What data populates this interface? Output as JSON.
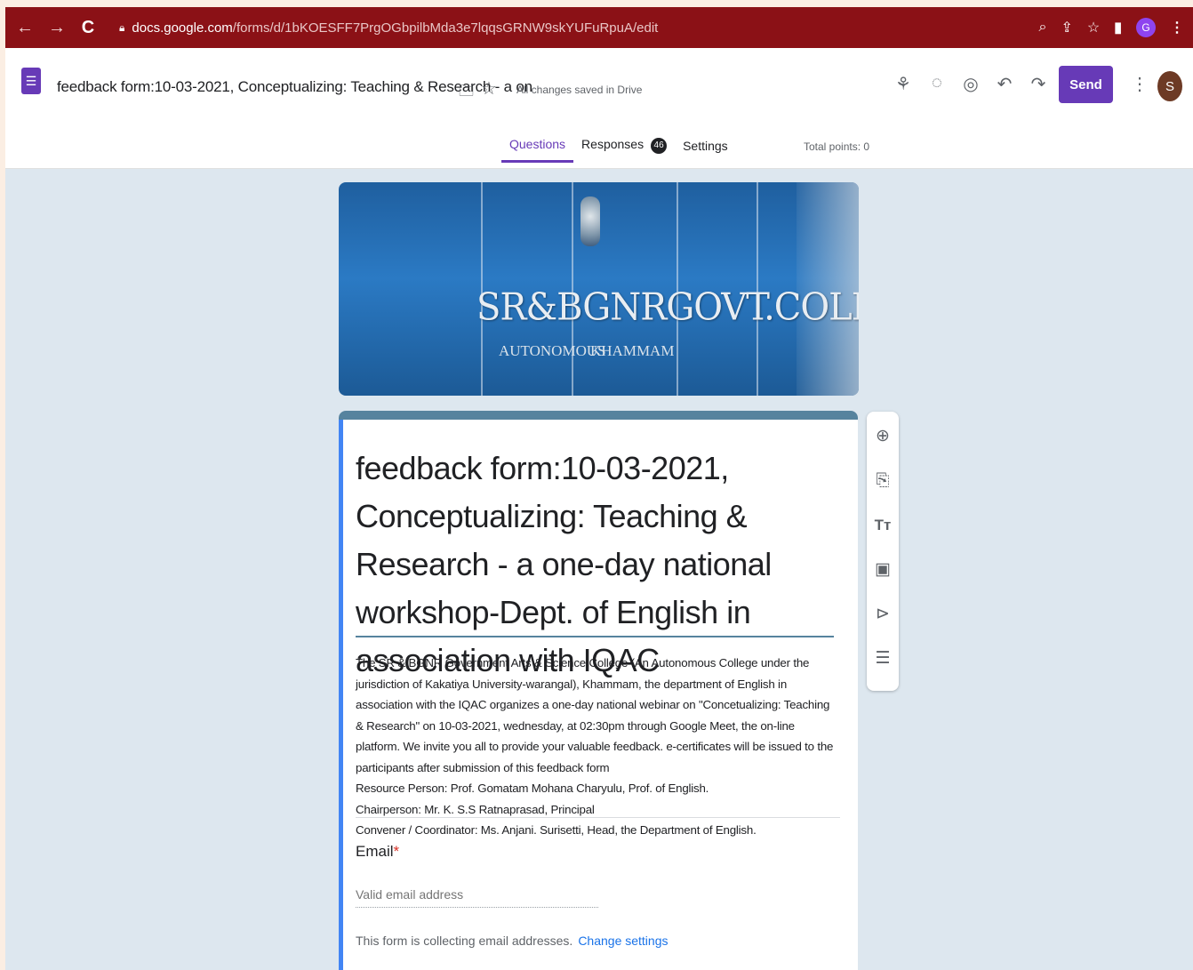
{
  "browser": {
    "url_host": "docs.google.com",
    "url_path": "/forms/d/1bKOESFF7PrgOGbpilbMda3e7lqqsGRNW9skYUFuRpuA/edit",
    "profile_initial": "G",
    "colors": {
      "toolbar": "#8b1116"
    }
  },
  "header": {
    "doc_title": "feedback form:10-03-2021, Conceptualizing: Teaching & Research - a on",
    "save_status": "All changes saved in Drive",
    "send_label": "Send",
    "user_initial": "S",
    "icons": [
      "addons-icon",
      "palette-icon",
      "preview-icon",
      "undo-icon",
      "redo-icon",
      "more-icon"
    ]
  },
  "tabs": [
    {
      "label": "Questions",
      "active": true
    },
    {
      "label": "Responses",
      "badge": "46"
    },
    {
      "label": "Settings"
    }
  ],
  "total_points": "Total points: 0",
  "banner": {
    "title": "SR&BGNRGOVT.COLLEGE",
    "sub_left": "AUTONOMOUS",
    "sub_right": "KHAMMAM"
  },
  "form": {
    "title": "feedback form:10-03-2021, Conceptualizing: Teaching & Research - a one-day national workshop-Dept. of English in association with IQAC",
    "description": [
      "The SR & BGNR Government Arts & Science College (An Autonomous College under the jurisdiction of Kakatiya University-warangal), Khammam, the department of English in association with the IQAC organizes a one-day national webinar on \"Concetualizing: Teaching & Research\" on 10-03-2021, wednesday, at 02:30pm through Google Meet, the on-line platform. We invite you all to provide your valuable feedback. e-certificates will be issued to the participants after submission of this feedback form",
      "Resource Person: Prof. Gomatam Mohana Charyulu, Prof. of English.",
      "Chairperson: Mr. K. S.S Ratnaprasad, Principal",
      "Convener / Coordinator: Ms. Anjani. Surisetti, Head, the Department of English."
    ],
    "email_label": "Email",
    "required_mark": "*",
    "email_placeholder": "Valid email address",
    "collect_note": "This form is collecting email addresses.",
    "change_settings": "Change settings",
    "accent": "#4285f4",
    "theme": "#56839e"
  },
  "side_toolbar": [
    "add-question-icon",
    "import-questions-icon",
    "add-title-icon",
    "add-image-icon",
    "add-video-icon",
    "add-section-icon"
  ]
}
